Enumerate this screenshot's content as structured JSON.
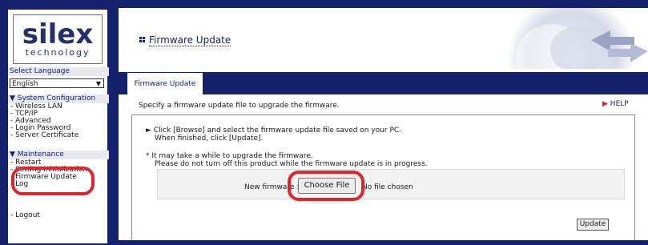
{
  "brand": {
    "logo_word": "silex",
    "logo_sub": "technology"
  },
  "sidebar": {
    "language_label": "Select Language",
    "language_value": "English",
    "system_config": {
      "heading": "▼ System Configuration",
      "items": [
        "- Wireless LAN",
        "- TCP/IP",
        "- Advanced",
        "- Login Password",
        "- Server Certificate"
      ]
    },
    "maintenance": {
      "heading": "▼ Maintenance",
      "items": [
        "- Restart",
        "- Setting Initialization",
        "- Firmware Update",
        "- Log"
      ]
    },
    "logout": "- Logout"
  },
  "page": {
    "title": "Firmware Update",
    "tab": "Firmware Update",
    "instruction": "Specify a firmware update file to upgrade the firmware.",
    "help": "HELP",
    "steps": [
      "► Click [Browse] and select the firmware update file saved on your PC.",
      "When finished, click [Update]."
    ],
    "notes": [
      "* It may take a while to upgrade the firmware.",
      "Please do not turn off this product while the firmware update is in progress."
    ],
    "file_label": "New firmware :",
    "choose_button": "Choose File",
    "no_file": "No file chosen",
    "update_button": "Update"
  },
  "colors": {
    "navy": "#16216b",
    "highlight_ring": "#e0242c"
  }
}
